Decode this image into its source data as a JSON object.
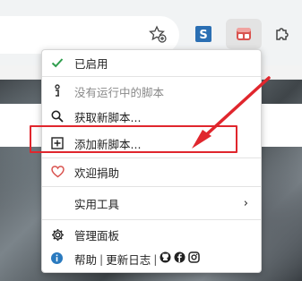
{
  "menu": {
    "items": [
      {
        "label": "已启用",
        "icon": "check-icon"
      },
      {
        "label": "没有运行中的脚本",
        "icon": "info-icon"
      },
      {
        "label": "获取新脚本...",
        "icon": "search-icon"
      },
      {
        "label": "添加新脚本...",
        "icon": "plus-square-icon"
      },
      {
        "label": "欢迎捐助",
        "icon": "heart-icon"
      },
      {
        "label": "实用工具",
        "icon": "",
        "chevron": "›"
      },
      {
        "label": "管理面板",
        "icon": "gear-icon"
      }
    ],
    "footer": {
      "help": "帮助",
      "separator": "|",
      "changelog": "更新日志",
      "separator2": "|"
    }
  },
  "colors": {
    "accent_green": "#2e9d4c",
    "highlight_red": "#e0262d",
    "heart_red": "#d9534f",
    "info_blue": "#2a7abf"
  }
}
